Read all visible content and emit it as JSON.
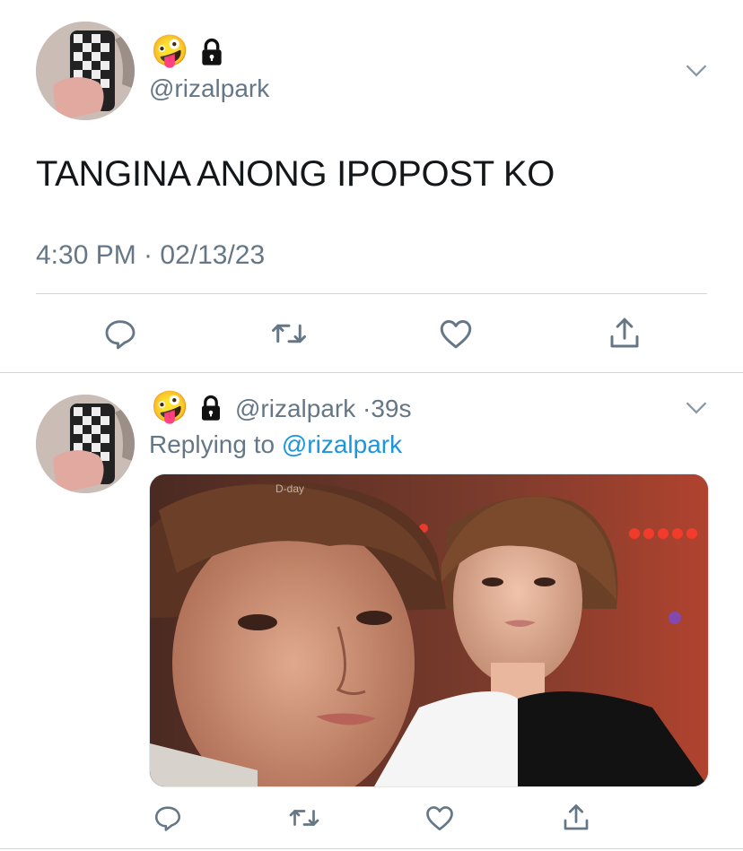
{
  "tweet": {
    "emoji": "🤪",
    "lock_icon": "lock-icon",
    "handle": "@rizalpark",
    "text": "TANGINA ANONG IPOPOST KO",
    "timestamp": "4:30 PM · 02/13/23",
    "actions": [
      "reply-icon",
      "retweet-icon",
      "like-icon",
      "share-icon"
    ]
  },
  "reply": {
    "emoji": "🤪",
    "handle": "@rizalpark",
    "separator": "·",
    "age": "39s",
    "replying_prefix": "Replying to ",
    "replying_handle": "@rizalpark",
    "media_caption": "D-day"
  },
  "colors": {
    "link": "#1b95e0",
    "secondary_text": "#657786",
    "divider": "#ccd6dd"
  }
}
